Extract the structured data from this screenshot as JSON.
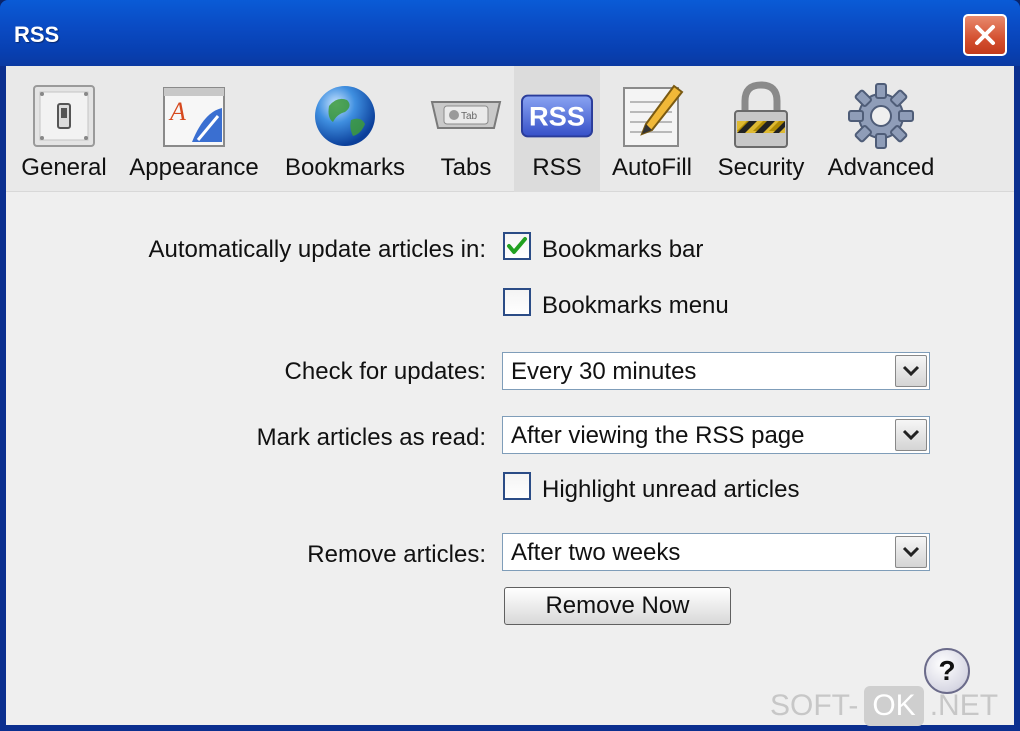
{
  "window": {
    "title": "RSS"
  },
  "toolbar": {
    "items": [
      {
        "label": "General",
        "icon": "general-switch-icon"
      },
      {
        "label": "Appearance",
        "icon": "appearance-icon"
      },
      {
        "label": "Bookmarks",
        "icon": "globe-icon"
      },
      {
        "label": "Tabs",
        "icon": "tabs-icon"
      },
      {
        "label": "RSS",
        "icon": "rss-icon",
        "selected": true
      },
      {
        "label": "AutoFill",
        "icon": "autofill-icon"
      },
      {
        "label": "Security",
        "icon": "lock-icon"
      },
      {
        "label": "Advanced",
        "icon": "gear-icon"
      }
    ]
  },
  "rss": {
    "auto_update_label": "Automatically update articles in:",
    "bookmarks_bar": {
      "label": "Bookmarks bar",
      "checked": true
    },
    "bookmarks_menu": {
      "label": "Bookmarks menu",
      "checked": false
    },
    "check_updates_label": "Check for updates:",
    "check_updates_value": "Every 30 minutes",
    "mark_read_label": "Mark articles as read:",
    "mark_read_value": "After viewing the RSS page",
    "highlight_unread": {
      "label": "Highlight unread articles",
      "checked": false
    },
    "remove_label": "Remove articles:",
    "remove_value": "After two weeks",
    "remove_now_button": "Remove Now",
    "help_button": "?"
  },
  "watermark": {
    "prefix": "SOFT-",
    "box": "OK",
    "suffix": ".NET"
  },
  "colors": {
    "title_bar": "#0a4bc4",
    "close_button": "#d45030",
    "check_mark": "#21a121"
  }
}
